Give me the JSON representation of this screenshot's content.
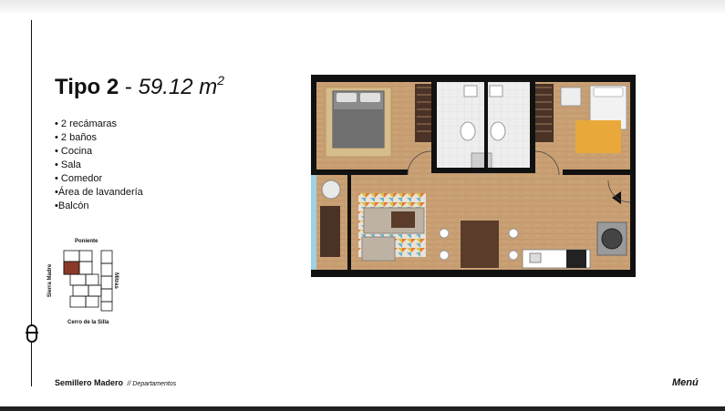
{
  "header": {
    "type_label": "Tipo 2",
    "separator": " - ",
    "area": "59.12 m",
    "area_sup": "2"
  },
  "features": [
    "• 2 recámaras",
    "• 2 baños",
    "• Cocina",
    "• Sala",
    "• Comedor",
    "•Área de lavandería",
    "•Balcón"
  ],
  "keyplan": {
    "north": "Poniente",
    "south": "Cerro de la Silla",
    "west": "Sierra Madre",
    "east": "Mitras",
    "highlight_color": "#8b3a2a"
  },
  "footer": {
    "brand": "Semillero Madero",
    "section": "// Departamentos",
    "menu": "Menú"
  },
  "colors": {
    "wood_floor": "#c89f73",
    "wall": "#111111",
    "tile": "#e8e8e8",
    "balcony_glass": "#9fd0e6"
  }
}
